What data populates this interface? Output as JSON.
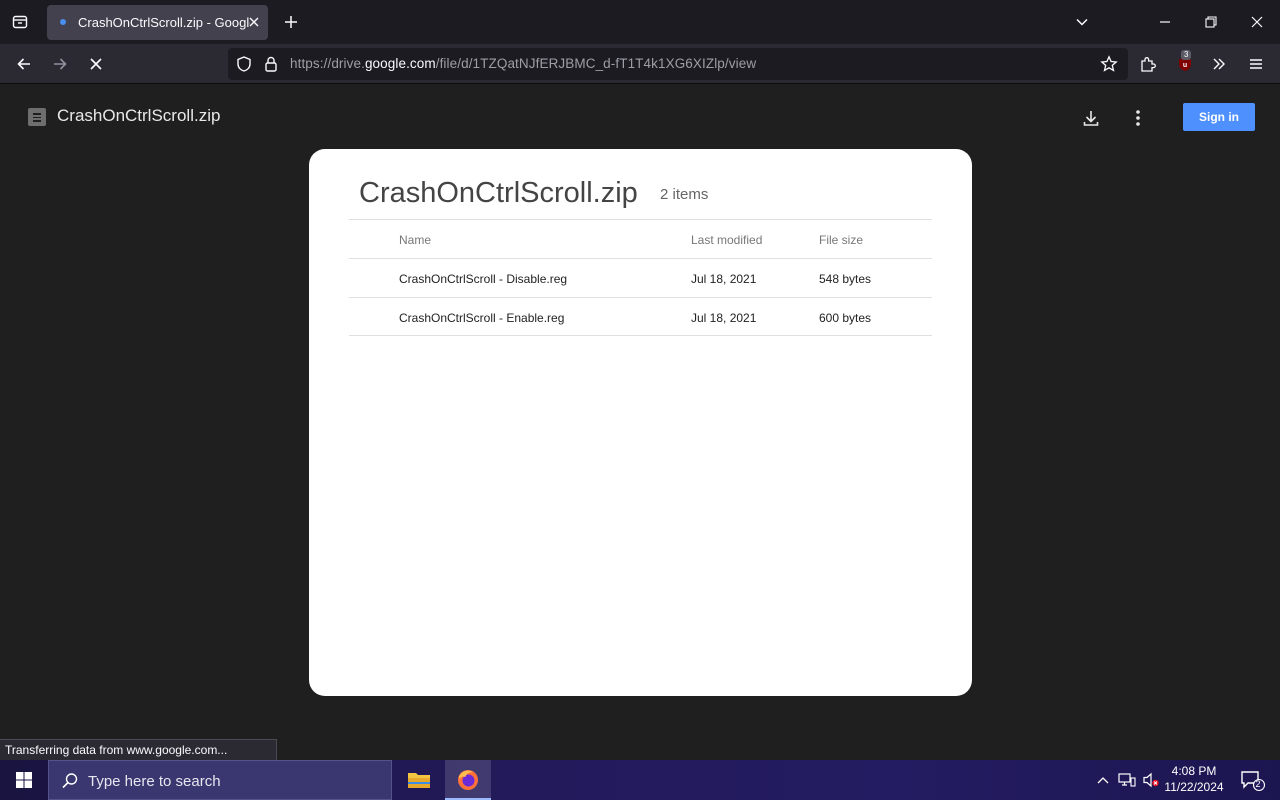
{
  "browser": {
    "tab": {
      "title": "CrashOnCtrlScroll.zip - Google Drive"
    },
    "url": {
      "prefix": "https://drive.",
      "host": "google.com",
      "path": "/file/d/1TZQatNJfERJBMC_d-fT1T4k1XG6XIZlp/view"
    },
    "extension_badge": "3",
    "status_text": "Transferring data from www.google.com..."
  },
  "viewer": {
    "title": "CrashOnCtrlScroll.zip",
    "sign_in_label": "Sign in"
  },
  "archive": {
    "title": "CrashOnCtrlScroll.zip",
    "count": "2 items",
    "columns": {
      "name": "Name",
      "modified": "Last modified",
      "size": "File size"
    },
    "rows": [
      {
        "name": "CrashOnCtrlScroll - Disable.reg",
        "modified": "Jul 18, 2021",
        "size": "548 bytes"
      },
      {
        "name": "CrashOnCtrlScroll - Enable.reg",
        "modified": "Jul 18, 2021",
        "size": "600 bytes"
      }
    ]
  },
  "taskbar": {
    "search_placeholder": "Type here to search",
    "time": "4:08 PM",
    "date": "11/22/2024",
    "notification_count": "2"
  },
  "colors": {
    "accent": "#4d90fe",
    "taskbar": "#221a5a",
    "page_bg": "#1f1f1f"
  }
}
